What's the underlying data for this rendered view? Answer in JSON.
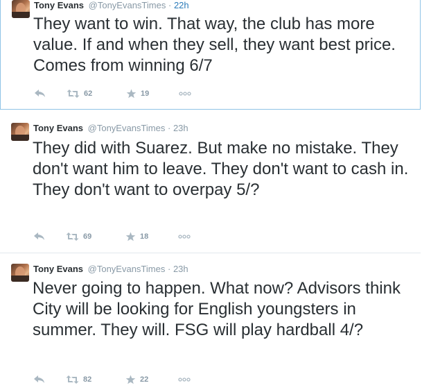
{
  "tweets": [
    {
      "name": "Tony Evans",
      "handle": "@TonyEvansTimes",
      "separator": "·",
      "time": "22h",
      "text": "They want to win. That way, the club has more value. If and when they sell, they want best price. Comes from winning 6/7",
      "retweets": "62",
      "favorites": "19"
    },
    {
      "name": "Tony Evans",
      "handle": "@TonyEvansTimes",
      "separator": "·",
      "time": "23h",
      "text": "They did with Suarez. But make no mistake. They don't want him to leave. They don't want to cash in. They don't want to overpay 5/?",
      "retweets": "69",
      "favorites": "18"
    },
    {
      "name": "Tony Evans",
      "handle": "@TonyEvansTimes",
      "separator": "·",
      "time": "23h",
      "text": "Never going to happen. What now? Advisors think City will be looking for English youngsters in summer. They will. FSG will play hardball 4/?",
      "retweets": "82",
      "favorites": "22"
    }
  ],
  "icons": {
    "reply": "reply-icon",
    "retweet": "retweet-icon",
    "favorite": "star-icon",
    "more": "more-icon"
  },
  "colors": {
    "accent_link": "#2b7bb9",
    "muted": "#8899a6",
    "highlight_border": "#8ec3e6"
  }
}
